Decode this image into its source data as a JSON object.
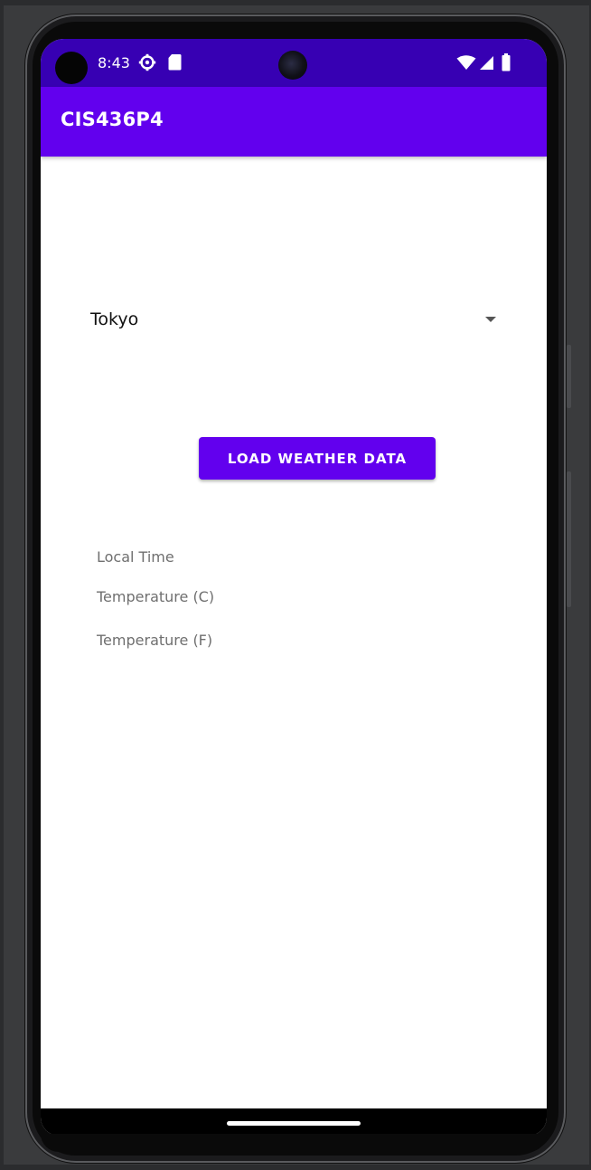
{
  "status_bar": {
    "time": "8:43",
    "icons": [
      "settings-gear-icon",
      "sd-card-icon",
      "wifi-icon",
      "cell-signal-icon",
      "battery-icon"
    ]
  },
  "app_bar": {
    "title": "CIS436P4"
  },
  "city_spinner": {
    "selected": "Tokyo"
  },
  "load_button": {
    "label": "LOAD WEATHER DATA"
  },
  "info": {
    "local_time_label": "Local Time",
    "temp_c_label": "Temperature (C)",
    "temp_f_label": "Temperature (F)"
  },
  "colors": {
    "status_bar": "#3700b3",
    "primary": "#6200ee",
    "background": "#ffffff"
  }
}
